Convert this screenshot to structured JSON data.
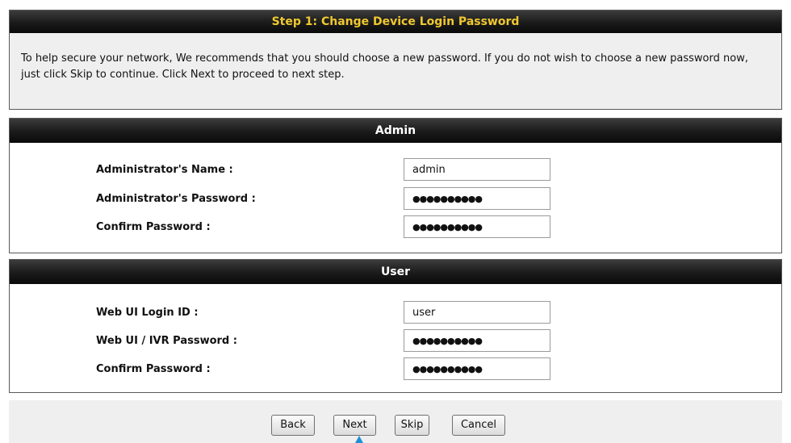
{
  "step": {
    "title": "Step 1: Change Device Login Password",
    "description": "To help secure your network, We recommends that you should choose a new password. If you do not wish to choose a new password now, just click Skip to continue. Click Next to proceed to next step."
  },
  "admin": {
    "header": "Admin",
    "fields": [
      {
        "label": "Administrator's Name :",
        "value": "admin"
      },
      {
        "label": "Administrator's Password :",
        "value": "●●●●●●●●●●"
      },
      {
        "label": "Confirm Password :",
        "value": "●●●●●●●●●●"
      }
    ]
  },
  "user": {
    "header": "User",
    "fields": [
      {
        "label": "Web UI Login ID :",
        "value": "user"
      },
      {
        "label": "Web UI / IVR Password :",
        "value": "●●●●●●●●●●"
      },
      {
        "label": "Confirm Password :",
        "value": "●●●●●●●●●●"
      }
    ]
  },
  "buttons": {
    "back": "Back",
    "next": "Next",
    "skip": "Skip",
    "cancel": "Cancel"
  },
  "colors": {
    "title_accent": "#f0c830",
    "bar_background": "#1a1a1a",
    "panel_background": "#efefef",
    "cursor": "#1f8fd8"
  }
}
